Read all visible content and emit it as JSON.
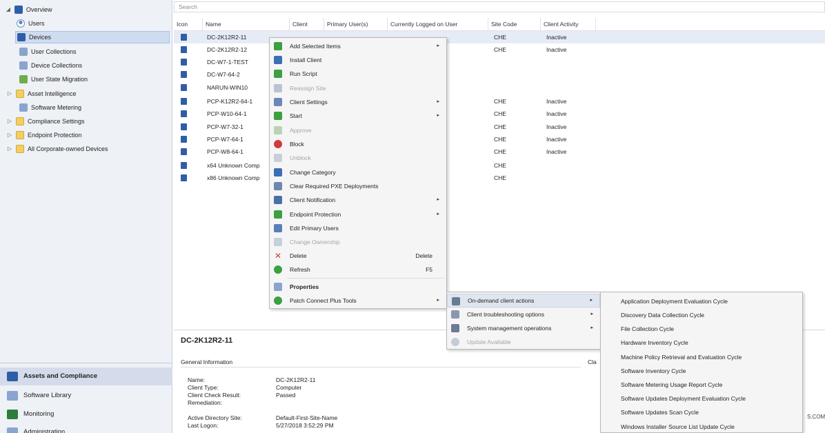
{
  "nav": {
    "tree": [
      {
        "label": "Overview",
        "expander": "◢",
        "icon": "dev"
      },
      {
        "label": "Users",
        "icon": "user"
      },
      {
        "label": "Devices",
        "icon": "dev"
      },
      {
        "label": "User Collections",
        "icon": "coll"
      },
      {
        "label": "Device Collections",
        "icon": "coll"
      },
      {
        "label": "User State Migration",
        "icon": "green"
      },
      {
        "label": "Asset Intelligence",
        "expander": "▷",
        "icon": "folder"
      },
      {
        "label": "Software Metering",
        "icon": "coll"
      },
      {
        "label": "Compliance Settings",
        "expander": "▷",
        "icon": "folder"
      },
      {
        "label": "Endpoint Protection",
        "expander": "▷",
        "icon": "folder"
      },
      {
        "label": "All Corporate-owned Devices",
        "expander": "▷",
        "icon": "folder"
      }
    ],
    "workspaces": [
      {
        "label": "Assets and Compliance"
      },
      {
        "label": "Software Library"
      },
      {
        "label": "Monitoring"
      },
      {
        "label": "Administration"
      }
    ]
  },
  "search": {
    "placeholder": "Search"
  },
  "columns": [
    "Icon",
    "Name",
    "Client",
    "Primary User(s)",
    "Currently Logged on User",
    "Site Code",
    "Client Activity"
  ],
  "rows": [
    {
      "name": "DC-2K12R2-11",
      "site": "CHE",
      "activity": "Inactive"
    },
    {
      "name": "DC-2K12R2-12",
      "site": "CHE",
      "activity": "Inactive"
    },
    {
      "name": "DC-W7-1-TEST",
      "site": "",
      "activity": ""
    },
    {
      "name": "DC-W7-64-2",
      "site": "",
      "activity": ""
    },
    {
      "name": "NARUN-WIN10",
      "site": "",
      "activity": ""
    },
    {
      "name": "PCP-K12R2-64-1",
      "site": "CHE",
      "activity": "Inactive"
    },
    {
      "name": "PCP-W10-64-1",
      "site": "CHE",
      "activity": "Inactive"
    },
    {
      "name": "PCP-W7-32-1",
      "site": "CHE",
      "activity": "Inactive"
    },
    {
      "name": "PCP-W7-64-1",
      "site": "CHE",
      "activity": "Inactive"
    },
    {
      "name": "PCP-W8-64-1",
      "site": "CHE",
      "activity": "Inactive"
    },
    {
      "name": "x64 Unknown Comp",
      "site": "CHE",
      "activity": ""
    },
    {
      "name": "x86 Unknown Comp",
      "site": "CHE",
      "activity": ""
    }
  ],
  "details": {
    "title": "DC-2K12R2-11",
    "section": "General Information",
    "side_label": "Cla",
    "fields": [
      {
        "k": "Name:",
        "v": "DC-2K12R2-11"
      },
      {
        "k": "Client Type:",
        "v": "Computer"
      },
      {
        "k": "Client Check Result:",
        "v": "Passed"
      },
      {
        "k": "Remediation:",
        "v": ""
      },
      {
        "k": "Active Directory Site:",
        "v": "Default-First-Site-Name"
      },
      {
        "k": "Last Logon:",
        "v": "5/27/2018 3:52:29 PM"
      }
    ],
    "right_edge": "S.COM"
  },
  "context_menu": {
    "items": [
      {
        "label": "Add Selected Items",
        "arrow": "▸",
        "icon": "#3aa040"
      },
      {
        "label": "Install Client",
        "icon": "#3b6fb6"
      },
      {
        "label": "Run Script",
        "icon": "#3aa040"
      },
      {
        "label": "Reassign Site",
        "disabled": true,
        "icon": "#b9c3d3"
      },
      {
        "label": "Client Settings",
        "arrow": "▸",
        "icon": "#6b87b8"
      },
      {
        "label": "Start",
        "arrow": "▸",
        "icon": "#3aa040"
      },
      {
        "label": "Approve",
        "disabled": true,
        "icon": "#b9d3b4"
      },
      {
        "label": "Block",
        "icon": "#d23a3a"
      },
      {
        "label": "Unblock",
        "disabled": true,
        "icon": "#c9cfd9"
      },
      {
        "label": "Change Category",
        "icon": "#3b6fb6"
      },
      {
        "label": "Clear Required PXE Deployments",
        "icon": "#6f86b0"
      },
      {
        "label": "Client Notification",
        "arrow": "▸",
        "icon": "#4a6fa8"
      },
      {
        "label": "Endpoint Protection",
        "arrow": "▸",
        "icon": "#3aa040"
      },
      {
        "label": "Edit Primary Users",
        "icon": "#5a7fb8"
      },
      {
        "label": "Change Ownership",
        "disabled": true,
        "icon": "#c6cfdc"
      },
      {
        "label": "Delete",
        "shortcut": "Delete",
        "icon": "#d23a3a"
      },
      {
        "label": "Refresh",
        "shortcut": "F5",
        "icon": "#3aa040"
      },
      {
        "label": "Properties",
        "bold": true,
        "icon": "#8aa4cf"
      },
      {
        "label": "Patch Connect Plus Tools",
        "arrow": "▸",
        "icon": "#3aa040"
      }
    ]
  },
  "submenu1": {
    "items": [
      {
        "label": "On-demand client actions",
        "arrow": "▸",
        "icon": "#6b7b94"
      },
      {
        "label": "Client troubleshooting options",
        "arrow": "▸",
        "icon": "#8a98ad"
      },
      {
        "label": "System management operations",
        "arrow": "▸",
        "icon": "#6b7b94"
      },
      {
        "label": "Update Available",
        "disabled": true,
        "icon": "#c6ccd6"
      }
    ]
  },
  "submenu2": {
    "items": [
      {
        "label": "Application Deployment Evaluation Cycle"
      },
      {
        "label": "Discovery Data Collection Cycle"
      },
      {
        "label": "File Collection Cycle"
      },
      {
        "label": "Hardware Inventory Cycle"
      },
      {
        "label": "Machine Policy Retrieval and Evaluation Cycle"
      },
      {
        "label": "Software Inventory Cycle"
      },
      {
        "label": "Software Metering Usage Report Cycle"
      },
      {
        "label": "Software Updates Deployment Evaluation Cycle"
      },
      {
        "label": "Software Updates Scan Cycle"
      },
      {
        "label": "Windows Installer Source List Update Cycle"
      }
    ]
  }
}
